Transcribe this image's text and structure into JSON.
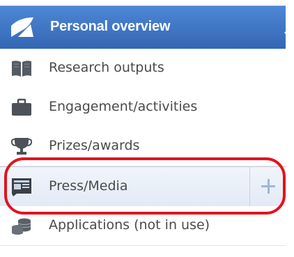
{
  "sidebar": {
    "header": {
      "label": "Personal overview",
      "icon": "personal-overview-icon",
      "collapse_icon": "collapse-arrow-icon"
    },
    "items": [
      {
        "label": "Research outputs",
        "icon": "book-icon"
      },
      {
        "label": "Engagement/activities",
        "icon": "briefcase-icon"
      },
      {
        "label": "Prizes/awards",
        "icon": "trophy-icon"
      },
      {
        "label": "Press/Media",
        "icon": "press-media-icon",
        "active": true,
        "add_icon": "plus-icon"
      },
      {
        "label": "Applications (not in use)",
        "icon": "coins-icon"
      }
    ]
  },
  "annotation": {
    "highlight_color": "#e0141d"
  },
  "colors": {
    "header_bg": "#3f78c8",
    "active_bg": "#e8eef8",
    "text": "#4a4a4a"
  }
}
